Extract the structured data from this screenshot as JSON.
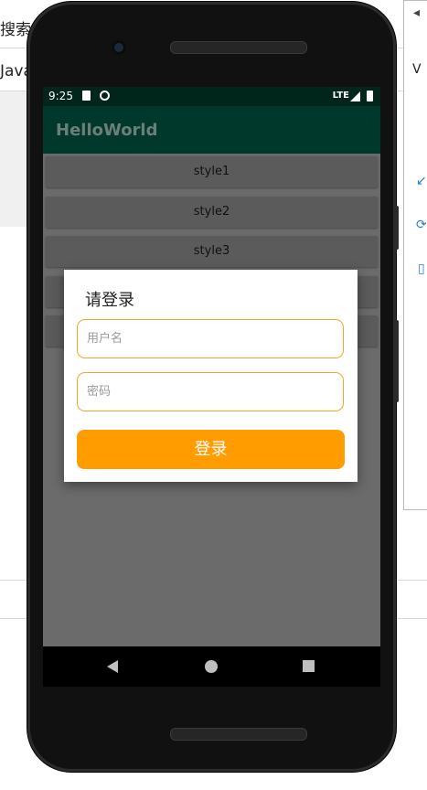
{
  "background": {
    "search_text": "搜索",
    "tab_text": "Java",
    "right_char": "V"
  },
  "status_bar": {
    "time": "9:25",
    "network": "LTE",
    "background_color": "#00251a"
  },
  "app_bar": {
    "title": "HelloWorld",
    "color": "#00392c"
  },
  "buttons": [
    {
      "label": "style1"
    },
    {
      "label": "style2"
    },
    {
      "label": "style3"
    }
  ],
  "dialog": {
    "title": "请登录",
    "username_placeholder": "用户名",
    "password_placeholder": "密码",
    "login_label": "登录",
    "accent_color": "#ff9c00",
    "field_border_color": "#f4a52a"
  },
  "nav_bar": {
    "icons": [
      "back-icon",
      "home-icon",
      "recents-icon"
    ]
  }
}
